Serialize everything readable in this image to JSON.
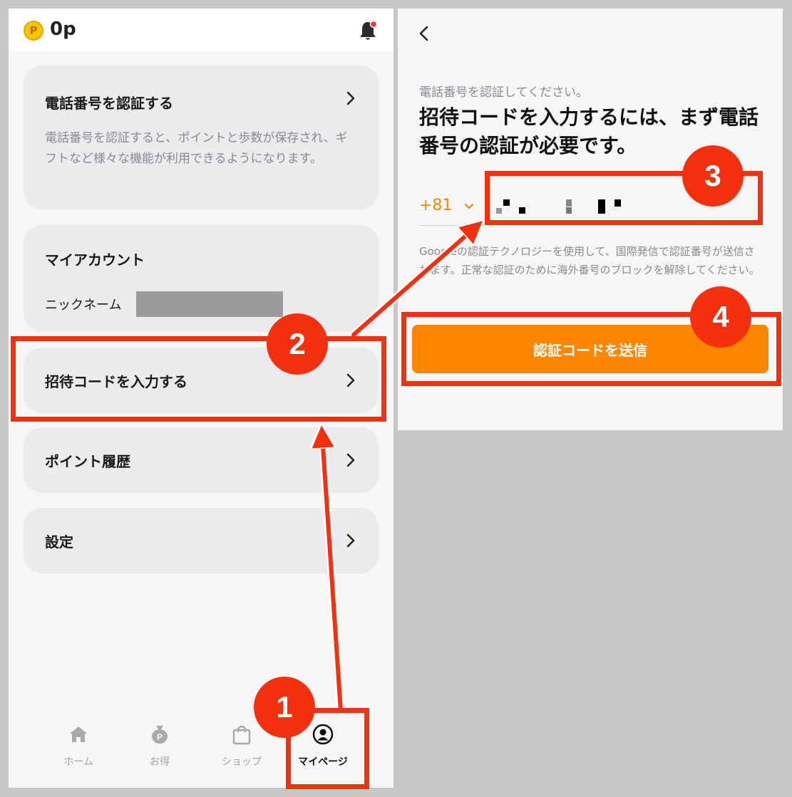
{
  "left": {
    "topbar": {
      "points_label": "0p",
      "coin_symbol": "P"
    },
    "cards": {
      "phone_verify": {
        "title": "電話番号を認証する",
        "description": "電話番号を認証すると、ポイントと歩数が保存され、ギフトなど様々な機能が利用できるようになります。"
      },
      "my_account": {
        "title": "マイアカウント",
        "nickname_label": "ニックネーム"
      },
      "invite_code": {
        "title": "招待コードを入力する"
      },
      "point_history": {
        "title": "ポイント履歴"
      },
      "settings": {
        "title": "設定"
      }
    },
    "bottom_nav": {
      "items": [
        {
          "label": "ホーム",
          "icon": "home-icon",
          "active": false
        },
        {
          "label": "お得",
          "icon": "points-bag-icon",
          "active": false
        },
        {
          "label": "ショップ",
          "icon": "shopping-bag-icon",
          "active": false
        },
        {
          "label": "マイページ",
          "icon": "profile-icon",
          "active": true
        }
      ]
    }
  },
  "right": {
    "sub_title": "電話番号を認証してください。",
    "main_title": "招待コードを入力するには、まず電話番号の認証が必要です。",
    "country_code": "+81",
    "notice": "Googleの認証テクノロジーを使用して、国際発信で認証番号が送信されます。正常な認証のために海外番号のブロックを解除してください。",
    "send_button": "認証コードを送信"
  },
  "annotations": {
    "steps": [
      "1",
      "2",
      "3",
      "4"
    ],
    "color": "#f5300f"
  },
  "colors": {
    "accent": "#ff8600",
    "country_code": "#f08a00",
    "muted_text": "#8a8a90",
    "card_bg": "#ebebed"
  }
}
